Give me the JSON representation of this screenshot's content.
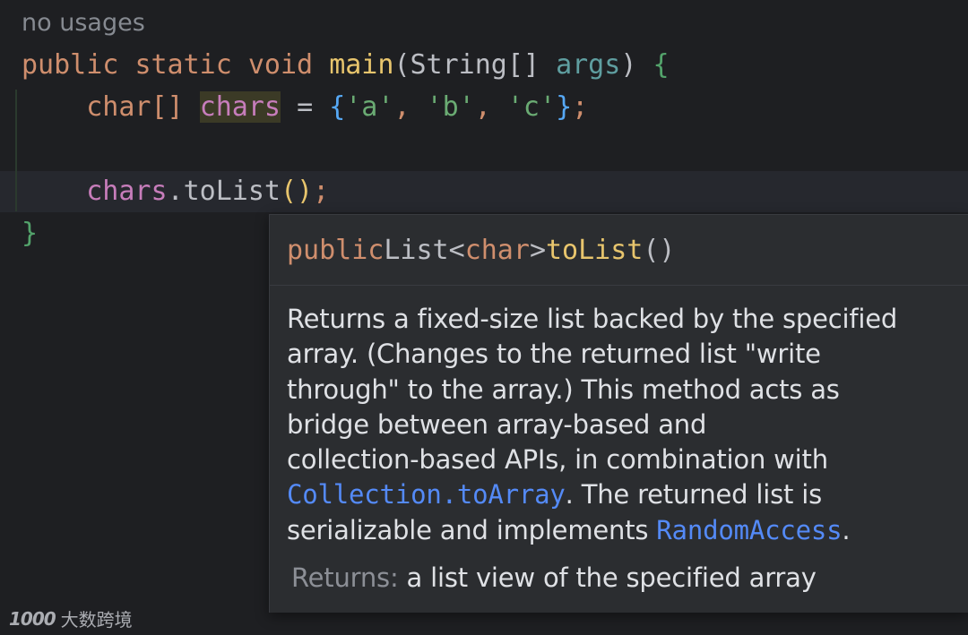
{
  "editor": {
    "usages_hint": "no usages",
    "lines": {
      "sig_public": "public",
      "sig_static": "static",
      "sig_void": "void",
      "sig_main": "main",
      "sig_paren_open": "(",
      "sig_string": "String",
      "sig_brackets": "[]",
      "sig_args": "args",
      "sig_paren_close": ")",
      "sig_brace": "{",
      "l2_type": "char[]",
      "l2_var": "chars",
      "l2_eq": "=",
      "l2_brace_open": "{",
      "l2_a": "'a'",
      "l2_b": "'b'",
      "l2_c": "'c'",
      "l2_brace_close": "}",
      "l2_semi": ";",
      "l4_var": "chars",
      "l4_dot": ".",
      "l4_method": "toList",
      "l4_parens": "()",
      "l4_semi": ";",
      "close_brace": "}"
    }
  },
  "popup": {
    "sig_public": "public",
    "sig_return": "List<",
    "sig_generic": "char",
    "sig_close": ">",
    "sig_name": "toList",
    "sig_parens": "()",
    "desc_line1": "Returns a fixed-size list backed by the specified",
    "desc_line2": "array. (Changes to the returned list \"write",
    "desc_line3": "through\" to the array.) This method acts as",
    "desc_line4": "bridge between array-based and",
    "desc_line5": "collection-based APIs, in combination with",
    "desc_link1": "Collection.toArray",
    "desc_line6_rest": ". The returned list is",
    "desc_line7": "serializable and implements ",
    "desc_link2": "RandomAccess",
    "desc_line7_end": ".",
    "returns_label": "Returns:",
    "returns_text": "a list view of the specified array"
  },
  "watermark": {
    "logo": "1000",
    "text": "大数跨境"
  },
  "colors": {
    "background": "#1e1f22",
    "popup_background": "#2b2d30",
    "keyword": "#cf8e6d",
    "method": "#e8c56d",
    "link": "#548af7",
    "variable": "#c77dbb",
    "string": "#6aab73"
  }
}
